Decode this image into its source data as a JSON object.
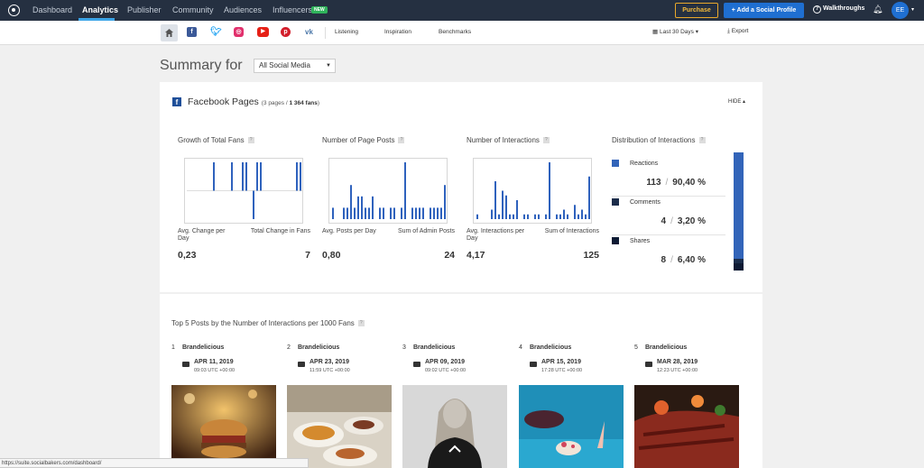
{
  "topnav": {
    "items": [
      "Dashboard",
      "Analytics",
      "Publisher",
      "Community",
      "Audiences",
      "Influencers"
    ],
    "new_badge": "NEW",
    "purchase": "Purchase",
    "add_profile": "+ Add a Social Profile",
    "walkthroughs": "Walkthroughs",
    "avatar": "EE"
  },
  "subnav": {
    "links": [
      "Listening",
      "Inspiration",
      "Benchmarks"
    ],
    "date_range": "Last 30 Days",
    "export": "Export"
  },
  "page": {
    "title": "Summary for",
    "select_value": "All Social Media"
  },
  "facebook": {
    "title": "Facebook Pages",
    "sub_prefix": "(3 pages / ",
    "sub_fans": "1 364 fans",
    "sub_suffix": ")",
    "hide": "HIDE",
    "sections": {
      "growth": "Growth of Total Fans",
      "posts": "Number of Page Posts",
      "interactions": "Number of Interactions",
      "distribution": "Distribution of Interactions"
    },
    "metrics": {
      "fans_avg_label": "Avg. Change per Day",
      "fans_avg_value": "0,23",
      "fans_total_label": "Total Change in Fans",
      "fans_total_value": "7",
      "posts_avg_label": "Avg. Posts per Day",
      "posts_avg_value": "0,80",
      "posts_total_label": "Sum of Admin Posts",
      "posts_total_value": "24",
      "int_avg_label": "Avg. Interactions per Day",
      "int_avg_value": "4,17",
      "int_total_label": "Sum of Interactions",
      "int_total_value": "125"
    },
    "distribution": [
      {
        "name": "Reactions",
        "count": "113",
        "pct": "90,40 %",
        "share": 0.904,
        "color": "#3264b9"
      },
      {
        "name": "Comments",
        "count": "4",
        "pct": "3,20 %",
        "share": 0.032,
        "color": "#1b2c4a"
      },
      {
        "name": "Shares",
        "count": "8",
        "pct": "6,40 %",
        "share": 0.064,
        "color": "#0d1a33"
      }
    ]
  },
  "chart_data": [
    {
      "type": "bar",
      "title": "Growth of Total Fans",
      "values": [
        0,
        0,
        0,
        0,
        0,
        0,
        0,
        1,
        0,
        0,
        0,
        0,
        1,
        0,
        0,
        1,
        1,
        0,
        -1,
        1,
        1,
        0,
        0,
        0,
        0,
        0,
        0,
        0,
        0,
        0,
        1,
        1
      ],
      "ylim": [
        -1,
        1
      ]
    },
    {
      "type": "bar",
      "title": "Number of Page Posts",
      "values": [
        1,
        0,
        0,
        1,
        1,
        3,
        1,
        2,
        2,
        1,
        1,
        2,
        0,
        1,
        1,
        0,
        1,
        1,
        0,
        1,
        5,
        0,
        1,
        1,
        1,
        1,
        0,
        1,
        1,
        1,
        1,
        3
      ],
      "ylim": [
        0,
        5
      ]
    },
    {
      "type": "bar",
      "title": "Number of Interactions",
      "values": [
        1,
        0,
        0,
        0,
        2,
        8,
        1,
        6,
        5,
        1,
        1,
        4,
        0,
        1,
        1,
        0,
        1,
        1,
        0,
        1,
        12,
        0,
        1,
        1,
        2,
        1,
        0,
        3,
        1,
        2,
        1,
        9
      ],
      "ylim": [
        0,
        12
      ]
    }
  ],
  "top5": {
    "title": "Top 5 Posts by the Number of Interactions per 1000 Fans",
    "posts": [
      {
        "num": "1",
        "name": "Brandelicious",
        "date": "APR 11, 2019",
        "time": "09:03 UTC +00:00"
      },
      {
        "num": "2",
        "name": "Brandelicious",
        "date": "APR 23, 2019",
        "time": "11:59 UTC +00:00"
      },
      {
        "num": "3",
        "name": "Brandelicious",
        "date": "APR 09, 2019",
        "time": "09:02 UTC +00:00"
      },
      {
        "num": "4",
        "name": "Brandelicious",
        "date": "APR 15, 2019",
        "time": "17:28 UTC +00:00"
      },
      {
        "num": "5",
        "name": "Brandelicious",
        "date": "MAR 28, 2019",
        "time": "12:23 UTC +00:00"
      }
    ]
  },
  "statusbar": "https://suite.socialbakers.com/dashboard/"
}
